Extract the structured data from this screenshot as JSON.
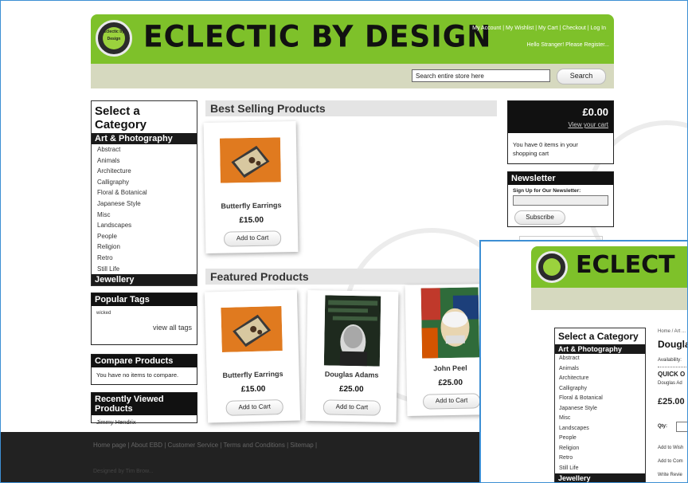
{
  "brand": "ECLECTIC BY DESIGN",
  "brand_short": "ECLECT",
  "logo_text": "Eclectic by Design",
  "top_links": "My Account | My Wishlist | My Cart | Checkout | Log In",
  "welcome": "Hello Stranger! Please Register...",
  "search": {
    "placeholder": "Search entire store here",
    "button": "Search"
  },
  "categories": {
    "heading": "Select a Category",
    "groups": [
      {
        "label": "Art & Photography",
        "items": [
          "Abstract",
          "Animals",
          "Architecture",
          "Calligraphy",
          "Floral & Botanical",
          "Japanese Style",
          "Misc",
          "Landscapes",
          "People",
          "Religion",
          "Retro",
          "Still Life"
        ]
      },
      {
        "label": "Jewellery",
        "items": []
      }
    ]
  },
  "popular_tags": {
    "title": "Popular Tags",
    "tag": "wicked",
    "view_all": "view all tags"
  },
  "compare": {
    "title": "Compare Products",
    "text": "You have no items to compare."
  },
  "recent": {
    "title": "Recently Viewed Products",
    "item": "Jimmy Hendrix"
  },
  "best_selling": {
    "title": "Best Selling Products",
    "products": [
      {
        "name": "Butterfly Earrings",
        "price": "£15.00",
        "button": "Add to Cart"
      }
    ]
  },
  "featured": {
    "title": "Featured Products",
    "products": [
      {
        "name": "Butterfly Earrings",
        "price": "£15.00",
        "button": "Add to Cart"
      },
      {
        "name": "Douglas Adams",
        "price": "£25.00",
        "button": "Add to Cart"
      },
      {
        "name": "John Peel",
        "price": "£25.00",
        "button": "Add to Cart"
      }
    ]
  },
  "cart": {
    "total": "£0.00",
    "view": "View your cart",
    "text": "You have 0 items in your shopping cart"
  },
  "newsletter": {
    "title": "Newsletter",
    "label": "Sign Up for Our Newsletter:",
    "button": "Subscribe"
  },
  "footer": {
    "links": "Home page  | About EBD  | Customer Service  | Terms and Conditions  | Sitemap  |",
    "credit": "Designed by Tim Brow..."
  },
  "second_window": {
    "breadcrumb": "Home / Art ...",
    "product_title": "Dougla",
    "availability": "Availability:",
    "quick_overview": "QUICK O",
    "desc": "Douglas Ad",
    "price": "£25.00",
    "qty_label": "Qty:",
    "add_wishlist": "Add to Wish",
    "add_compare": "Add to Com",
    "write_review": "Write Revie",
    "categories_heading": "Select a Category",
    "group": "Art & Photography",
    "items": [
      "Abstract",
      "Animals",
      "Architecture",
      "Calligraphy",
      "Floral & Botanical",
      "Japanese Style",
      "Misc",
      "Landscapes",
      "People",
      "Religion",
      "Retro",
      "Still Life"
    ],
    "group2": "Jewellery"
  }
}
